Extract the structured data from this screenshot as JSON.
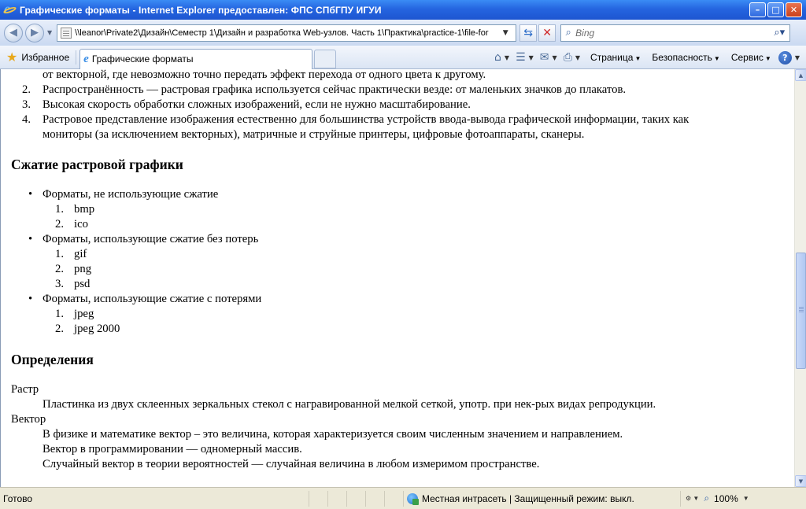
{
  "window": {
    "title": "Графические форматы - Internet Explorer предоставлен: ФПС СПбГПУ ИГУИ",
    "minimize": "–",
    "maximize": "□",
    "close": "✕"
  },
  "nav": {
    "back_icon": "back-arrow-icon",
    "forward_icon": "forward-arrow-icon",
    "address": "\\\\leanor\\Private2\\Дизайн\\Семестр 1\\Дизайн и разработка Web-узлов. Часть 1\\Практика\\practice-1\\file-for",
    "search_placeholder": "Bing"
  },
  "favorites": {
    "label": "Избранное",
    "tab_title": "Графические форматы"
  },
  "commands": {
    "page": "Страница",
    "security": "Безопасность",
    "service": "Сервис",
    "help": "?"
  },
  "content": {
    "top_list": [
      {
        "num": "",
        "lines": [
          "от векторной, где невозможно точно передать эффект перехода от одного цвета к другому."
        ]
      },
      {
        "num": "2.",
        "lines": [
          "Распространённость — растровая графика используется сейчас практически везде: от маленьких значков до плакатов."
        ]
      },
      {
        "num": "3.",
        "lines": [
          "Высокая скорость обработки сложных изображений, если не нужно масштабирование."
        ]
      },
      {
        "num": "4.",
        "lines": [
          "Растровое представление изображения естественно для большинства устройств ввода-вывода графической информации, таких как",
          "мониторы (за исключением векторных), матричные и струйные принтеры, цифровые фотоаппараты, сканеры."
        ]
      }
    ],
    "heading_compression": "Сжатие растровой графики",
    "groups": [
      {
        "label": "Форматы, не использующие сжатие",
        "items": [
          "bmp",
          "ico"
        ]
      },
      {
        "label": "Форматы, использующие сжатие без потерь",
        "items": [
          "gif",
          "png",
          "psd"
        ]
      },
      {
        "label": "Форматы, использующие сжатие с потерями",
        "items": [
          "jpeg",
          "jpeg 2000"
        ]
      }
    ],
    "heading_definitions": "Определения",
    "definitions": [
      {
        "term": "Растр",
        "descs": [
          "Пластинка из двух склеенных зеркальных стекол с награвированной мелкой сеткой, употр. при нек-рых видах репродукции."
        ]
      },
      {
        "term": "Вектор",
        "descs": [
          "В физике и математике вектор – это величина, которая характеризуется своим численным значением и направлением.",
          "Вектор в программировании — одномерный массив.",
          "Случайный вектор в теории вероятностей — случайная величина в любом измеримом пространстве."
        ]
      }
    ]
  },
  "status": {
    "text": "Готово",
    "zone": "Местная интрасеть | Защищенный режим: выкл.",
    "zoom": "100%"
  }
}
